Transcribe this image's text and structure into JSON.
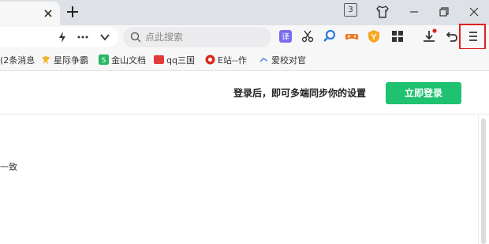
{
  "toolbar": {
    "tab_badge_count": "3",
    "search_placeholder": "点此搜索"
  },
  "bookmarks": [
    {
      "label": "(2条消息",
      "color": "#3b7ddd"
    },
    {
      "label": "星际争霸",
      "color": "#f0b429"
    },
    {
      "label": "金山文档",
      "color": "#25b864"
    },
    {
      "label": "qq三国",
      "color": "#e23a3a"
    },
    {
      "label": "E站--作",
      "color": "#d62d20"
    },
    {
      "label": "爱校对官",
      "color": "#5a8fd8"
    }
  ],
  "login": {
    "prompt": "登录后，即可多端同步你的设置",
    "button_label": "立即登录"
  },
  "content": {
    "snippet": "一致"
  },
  "colors": {
    "accent_green": "#1fc271",
    "highlight_red": "#e02020"
  }
}
